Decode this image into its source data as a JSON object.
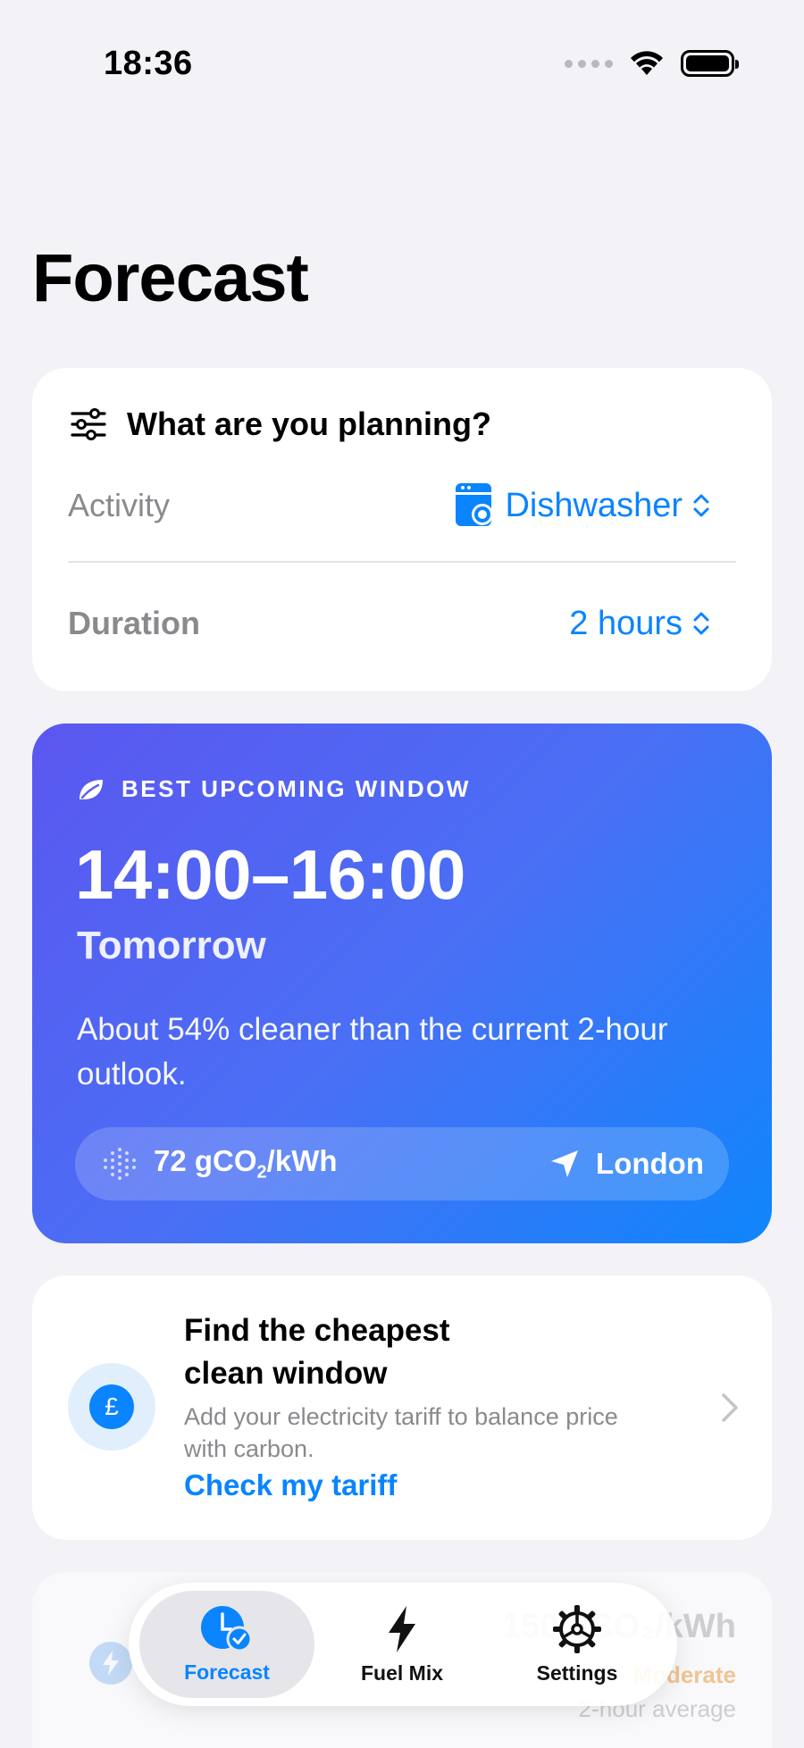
{
  "status_bar": {
    "time": "18:36"
  },
  "page": {
    "title": "Forecast"
  },
  "planning": {
    "header": "What are you planning?",
    "activity_label": "Activity",
    "activity_value": "Dishwasher",
    "duration_label": "Duration",
    "duration_value": "2 hours"
  },
  "best_window": {
    "label": "BEST UPCOMING WINDOW",
    "time_range": "14:00–16:00",
    "day": "Tomorrow",
    "description": "About 54% cleaner than the current 2-hour outlook.",
    "intensity_value": "72 gCO",
    "intensity_sub": "2",
    "intensity_unit": "/kWh",
    "location": "London"
  },
  "tariff": {
    "title": "Find the cheapest clean window",
    "description": "Add your electricity tariff to balance price with carbon.",
    "link": "Check my tariff",
    "currency_symbol": "£"
  },
  "peek_card": {
    "value": "150 gCO₂/kWh",
    "status": "Moderate",
    "sub": "2-hour average"
  },
  "tabs": [
    {
      "label": "Forecast",
      "icon": "clock-check-icon",
      "active": true
    },
    {
      "label": "Fuel Mix",
      "icon": "bolt-icon",
      "active": false
    },
    {
      "label": "Settings",
      "icon": "gear-icon",
      "active": false
    }
  ],
  "colors": {
    "accent": "#0a84ff",
    "background": "#f2f2f7",
    "gradient_start": "#5b57f0",
    "gradient_end": "#0f86fb"
  }
}
